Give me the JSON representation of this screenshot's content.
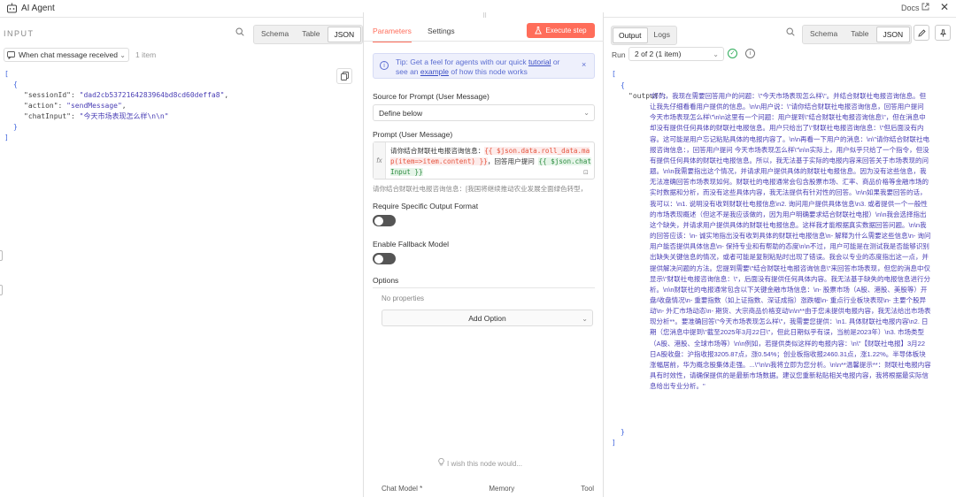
{
  "window": {
    "title": "AI Agent",
    "docs_label": "Docs",
    "icons": {
      "app": "robot-icon",
      "external": "external-link-icon",
      "close": "close-icon"
    }
  },
  "input_panel": {
    "heading": "INPUT",
    "view_tabs": [
      "Schema",
      "Table",
      "JSON"
    ],
    "active_view": "JSON",
    "node_select": "When chat message received",
    "item_count": "1 item",
    "json": {
      "sessionId_key": "\"sessionId\"",
      "sessionId_val": "\"dad2cb5372164283964bd8cd60deffa8\"",
      "action_key": "\"action\"",
      "action_val": "\"sendMessage\"",
      "chatInput_key": "\"chatInput\"",
      "chatInput_val": "\"今天市场表现怎么样\\n\\n\""
    }
  },
  "parameters_panel": {
    "tabs": [
      "Parameters",
      "Settings"
    ],
    "active_tab": "Parameters",
    "execute_button": "Execute step",
    "tip": {
      "prefix": "Tip: Get a feel for agents with our quick ",
      "link1": "tutorial",
      "middle": " or see an ",
      "link2": "example",
      "suffix": " of how this node works"
    },
    "source_label": "Source for Prompt (User Message)",
    "source_value": "Define below",
    "prompt_label": "Prompt (User Message)",
    "prompt": {
      "text1": "请你结合财联社电报咨询信息：",
      "expr1": "{{ $json.data.roll_data.map(item=>item.content) }}",
      "text2": "，回答用户提问 ",
      "expr2": "{{ $json.chatInput }}"
    },
    "prompt_preview": "请你结合财联社电报咨询信息：[我国将继续推动农业发展全面绿色转型，",
    "require_format_label": "Require Specific Output Format",
    "require_format_on": false,
    "fallback_label": "Enable Fallback Model",
    "fallback_on": false,
    "options_label": "Options",
    "no_properties": "No properties",
    "add_option": "Add Option",
    "wish_text": "I wish this node would...",
    "sub_nodes": [
      "Chat Model *",
      "Memory",
      "Tool"
    ]
  },
  "output_panel": {
    "view_tabs_left": [
      "Output",
      "Logs"
    ],
    "active_left": "Output",
    "view_tabs": [
      "Schema",
      "Table",
      "JSON"
    ],
    "active_view": "JSON",
    "run_label": "Run",
    "run_value": "2 of 2 (1 item)",
    "output_key": "\"output\":",
    "output_value": "\"好的，我现在需要回答用户的问题：\\\"今天市场表现怎么样\\\"。并结合财联社电报咨询信息。但让我先仔细看看用户提供的信息。\\n\\n用户说：\\\"请你结合财联社电报咨询信息，回答用户提问 今天市场表现怎么样\\\"\\n\\n这里有一个问题：用户提到\\\"结合财联社电报咨询信息\\\"，但在消息中却没有提供任何具体的财联社电报信息。用户只给出了\\\"财联社电报咨询信息：\\\"但后面没有内容。这可能是用户忘记粘贴具体的电报内容了。\\n\\n再看一下用户的消息：\\n\\\"请你结合财联社电报咨询信息：，回答用户提问 今天市场表现怎么样\\\"\\n\\n实际上，用户似乎只给了一个指令，但没有提供任何具体的财联社电报信息。所以，我无法基于实际的电报内容来回答关于市场表现的问题。\\n\\n我需要指出这个情况，并请求用户提供具体的财联社电报信息。因为没有这些信息，我无法准确回答市场表现如何。财联社的电报通常会包含股票市场、汇率、商品价格等金融市场的实时数据和分析，而没有这些具体内容，我无法提供有针对性的回答。\\n\\n如果我要回答的话，我可以：\\n1. 说明没有收到财联社电报信息\\n2. 询问用户提供具体信息\\n3. 或者提供一个一般性的市场表现概述（但这不是我应该做的，因为用户明确要求结合财联社电报）\\n\\n我会选择指出这个缺失，并请求用户提供具体的财联社电报信息。这样我才能根据真实数据回答问题。\\n\\n我的回答应该：\\n- 诚实地指出没有收到具体的财联社电报信息\\n- 解释为什么需要这些信息\\n- 询问用户能否提供具体信息\\n- 保持专业和有帮助的态度\\n\\n不过，用户可能是在测试我是否能够识别出缺失关键信息的情况，或者可能是复制粘贴时出现了错误。我会以专业的态度指出这一点，并提供解决问题的方法。您提到需要\\\"结合财联社电报咨询信息\\\"来回答市场表现，但您的消息中仅显示\\\"财联社电报咨询信息：\\\"，后面没有提供任何具体内容。我无法基于缺失的电报信息进行分析。\\n\\n财联社的电报通常包含以下关键金融市场信息：\\n- 股票市场（A股、港股、美股等）开盘/收盘情况\\n- 重要指数（如上证指数、深证成指）涨跌幅\\n- 重点行业板块表现\\n- 主要个股异动\\n- 外汇市场动态\\n- 期货、大宗商品价格变动\\n\\n**由于您未提供电报内容，我无法给出市场表现分析**。要准确回答\\\"今天市场表现怎么样\\\"，我需要您提供：\\n1. 具体财联社电报内容\\n2. 日期（您消息中提到\\\"截至2025年3月22日\\\"，但此日期似乎有误，当前是2023年）\\n3. 市场类型（A股、港股、全球市场等）\\n\\n例如，若提供类似这样的电报内容：\\n\\\"【财联社电报】3月22日A股收盘：沪指收报3205.87点，涨0.54%；创业板指收报2460.31点，涨1.22%。半导体板块涨幅居前，华为概念股集体走强。...\\\"\\n\\n我将立即为您分析。\\n\\n**温馨提示**：财联社电报内容具有时效性，请确保提供的是最新市场数据。建议您重新粘贴相关电报内容，我将根据最实际信息给出专业分析。\""
  },
  "colors": {
    "accent": "#ff6d5a",
    "json_string": "#4a3fb5",
    "tip_bg": "#eef0fc",
    "expr_red": "#e5533d",
    "expr_green": "#2a8b3e"
  }
}
